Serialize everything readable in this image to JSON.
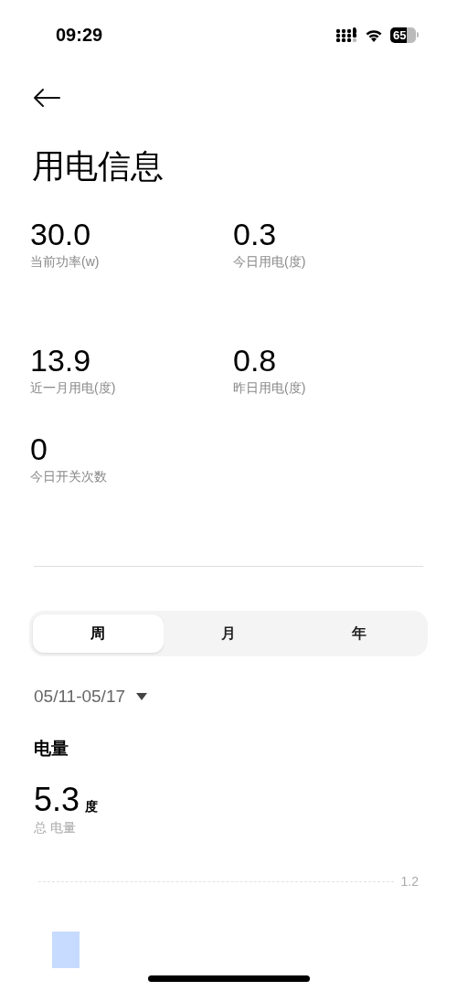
{
  "status_bar": {
    "time": "09:29",
    "battery": "65"
  },
  "title": "用电信息",
  "stats": [
    {
      "value": "30.0",
      "label": "当前功率(w)"
    },
    {
      "value": "0.3",
      "label": "今日用电(度)"
    },
    {
      "value": "13.9",
      "label": "近一月用电(度)"
    },
    {
      "value": "0.8",
      "label": "昨日用电(度)"
    },
    {
      "value": "0",
      "label": "今日开关次数"
    }
  ],
  "tabs": [
    {
      "label": "周",
      "selected": true
    },
    {
      "label": "月",
      "selected": false
    },
    {
      "label": "年",
      "selected": false
    }
  ],
  "date_range": "05/11-05/17",
  "section_title": "电量",
  "total": {
    "value": "5.3",
    "unit": "度",
    "label": "总 电量"
  },
  "chart": {
    "y_labels": [
      "1.2"
    ]
  }
}
